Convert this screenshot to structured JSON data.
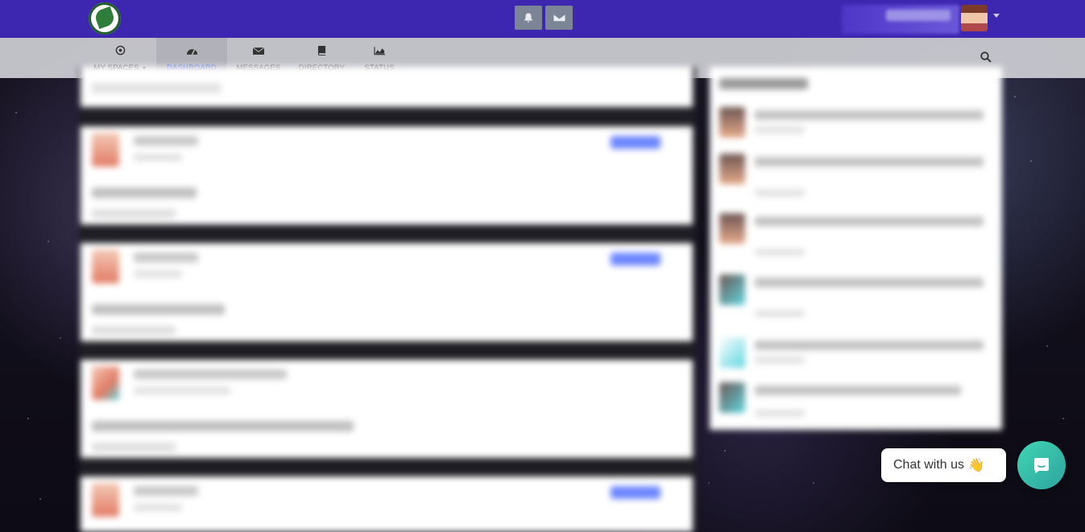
{
  "topbar": {
    "logo": "ssc-leaf-logo",
    "notifications_icon": "bell-icon",
    "messages_icon": "envelope-icon",
    "user_avatar": "user-avatar",
    "user_menu_icon": "caret-down-icon"
  },
  "nav": {
    "items": [
      {
        "label": "MY SPACES",
        "icon": "target-icon",
        "has_caret": true
      },
      {
        "label": "DASHBOARD",
        "icon": "dashboard-gauge-icon",
        "active": true
      },
      {
        "label": "MESSAGES",
        "icon": "envelope-icon"
      },
      {
        "label": "DIRECTORY",
        "icon": "book-icon"
      },
      {
        "label": "STATUS",
        "icon": "area-chart-icon"
      }
    ],
    "search_icon": "search-icon"
  },
  "chat": {
    "label": "Chat with us",
    "emoji": "👋",
    "button_icon": "chat-bubble-icon"
  },
  "colors": {
    "topbar": "#3d26b0",
    "navbar": "#cdcfd4",
    "active_nav": "#3b5bdb",
    "chat_gradient_start": "#3fd6b2",
    "chat_gradient_end": "#2fa3a0"
  }
}
